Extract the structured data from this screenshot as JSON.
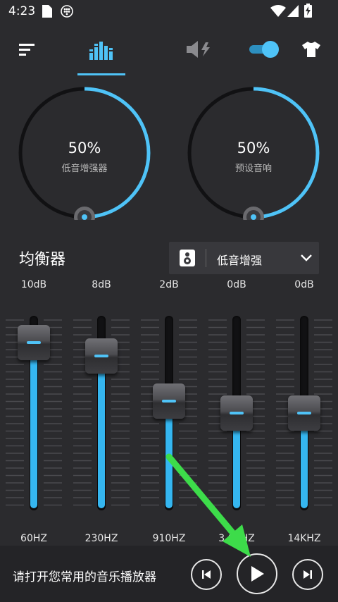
{
  "status_bar": {
    "time": "4:23",
    "icons": [
      "sim-card-icon",
      "app-notification-icon",
      "wifi-icon",
      "cellular-icon",
      "battery-charging-icon"
    ]
  },
  "nav": {
    "items": [
      "menu-icon",
      "equalizer-icon",
      "volume-boost-icon",
      "toggle-switch",
      "theme-shirt-icon"
    ],
    "active": "equalizer-icon",
    "toggle_on": true
  },
  "knobs": [
    {
      "value": "50%",
      "label": "低音增强器",
      "level": 0.5
    },
    {
      "value": "50%",
      "label": "预设音响",
      "level": 0.5
    }
  ],
  "equalizer": {
    "title": "均衡器",
    "preset": "低音增强",
    "bands": [
      {
        "db": "10dB",
        "freq": "60HZ",
        "level": 0.91
      },
      {
        "db": "8dB",
        "freq": "230HZ",
        "level": 0.83
      },
      {
        "db": "2dB",
        "freq": "910HZ",
        "level": 0.57
      },
      {
        "db": "0dB",
        "freq": "3.6KHZ",
        "level": 0.5
      },
      {
        "db": "0dB",
        "freq": "14KHZ",
        "level": 0.5
      }
    ]
  },
  "player": {
    "message": "请打开您常用的音乐播放器",
    "buttons": [
      "previous-icon",
      "play-icon",
      "next-icon"
    ]
  },
  "colors": {
    "accent": "#4fc3f7",
    "background": "#2b2b2e",
    "arrow": "#3ddc4a"
  }
}
